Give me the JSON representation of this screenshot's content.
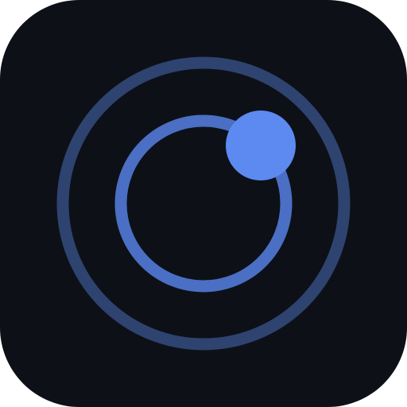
{
  "icon": {
    "name": "orbit-app-icon",
    "colors": {
      "background": "#0d1017",
      "outer_ring": "#2e4370",
      "inner_ring": "#4a6fc4",
      "dot": "#5c8af0"
    }
  }
}
